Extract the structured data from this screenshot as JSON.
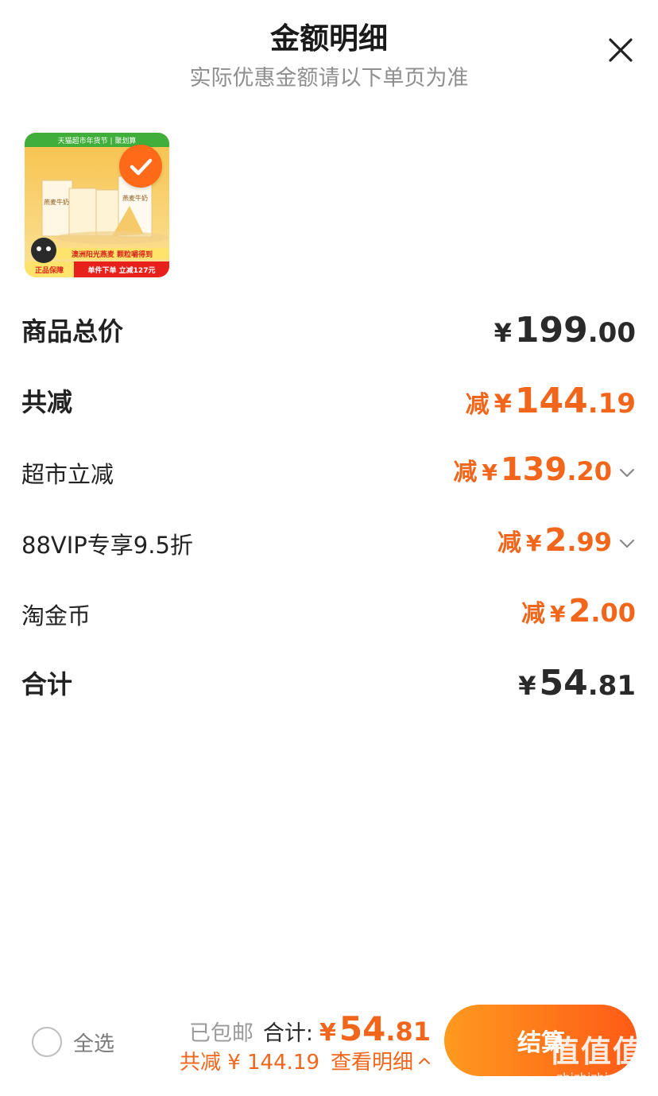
{
  "header": {
    "title": "金额明细",
    "subtitle": "实际优惠金额请以下单页为准"
  },
  "product": {
    "selected": true,
    "image_text": {
      "banner_top": "天猫超市年货节 | 聚划算",
      "box_text_left": "燕麦牛奶",
      "box_text_right": "燕麦牛奶",
      "promo_line": "澳洲阳光燕麦 颗粒嚼得到",
      "badge_left": "正品保障",
      "badge_right": "单件下单 立减127元"
    }
  },
  "rows": [
    {
      "label": "商品总价",
      "prefix": "",
      "yen": "¥",
      "int": "199",
      "dec": ".00",
      "color": "#2a2a2a",
      "expandable": false,
      "big": true
    },
    {
      "label": "共减",
      "prefix": "减",
      "yen": "¥",
      "int": "144",
      "dec": ".19",
      "color": "#f2661b",
      "expandable": false,
      "big": true
    },
    {
      "label": "超市立减",
      "prefix": "减",
      "yen": "¥",
      "int": "139",
      "dec": ".20",
      "color": "#f2661b",
      "expandable": true,
      "big": false
    },
    {
      "label": "88VIP专享9.5折",
      "prefix": "减",
      "yen": "¥",
      "int": "2",
      "dec": ".99",
      "color": "#f2661b",
      "expandable": true,
      "big": false
    },
    {
      "label": "淘金币",
      "prefix": "减",
      "yen": "¥",
      "int": "2",
      "dec": ".00",
      "color": "#f2661b",
      "expandable": false,
      "big": false
    },
    {
      "label": "合计",
      "prefix": "",
      "yen": "¥",
      "int": "54",
      "dec": ".81",
      "color": "#2a2a2a",
      "expandable": false,
      "big": true
    }
  ],
  "bottom_bar": {
    "select_all_label": "全选",
    "free_shipping": "已包邮",
    "total_label": "合计:",
    "total_yen": "¥",
    "total_int": "54",
    "total_dec": ".81",
    "discount_text": "共减 ¥ 144.19",
    "detail_link": "查看明细",
    "checkout_label": "结算"
  },
  "watermark": {
    "logo": "值值值",
    "url": "zhizhizhi.com"
  },
  "colors": {
    "accent": "#f2661b",
    "text": "#2a2a2a",
    "muted": "#8f8f8f"
  }
}
